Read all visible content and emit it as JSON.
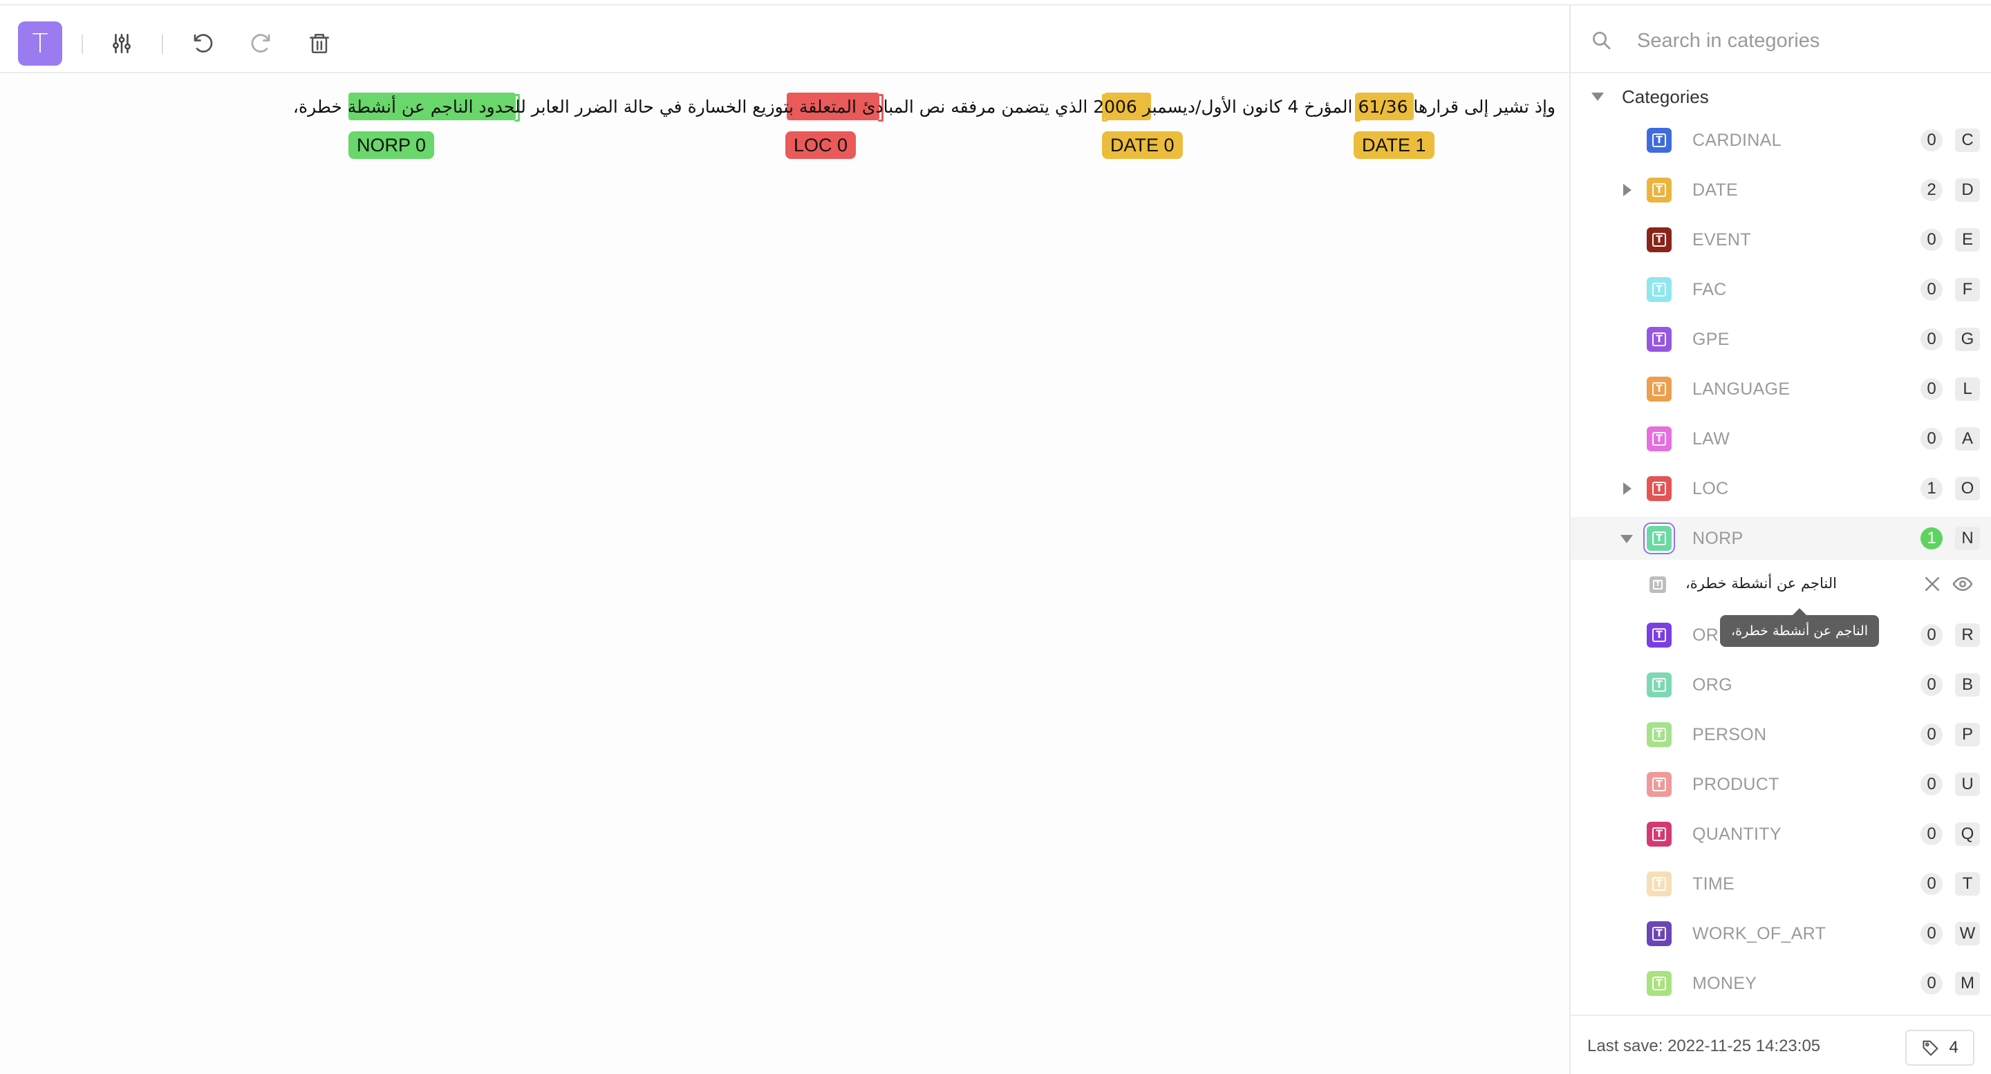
{
  "toolbar": {
    "text_tool_glyph": "T",
    "icons": [
      "text-tool-icon",
      "settings-sliders-icon",
      "undo-icon",
      "redo-icon",
      "trash-icon"
    ]
  },
  "document": {
    "text": "وإذ تشير إلى قرارها 61/36 المؤرخ 4 كانون الأول/ديسمبر 2006 الذي يتضمن مرفقه نص المبادئ المتعلقة بتوزيع الخسارة في حالة الضرر العابر للحدود الناجم عن أنشطة خطرة،",
    "labels": [
      {
        "name": "NORP",
        "index": "0",
        "text": "NORP 0",
        "color": "#69d76c"
      },
      {
        "name": "LOC",
        "index": "0",
        "text": "LOC 0",
        "color": "#ea5a5a"
      },
      {
        "name": "DATE",
        "index": "0",
        "text": "DATE 0",
        "color": "#ecbd3c"
      },
      {
        "name": "DATE",
        "index": "1",
        "text": "DATE 1",
        "color": "#ecbd3c"
      }
    ]
  },
  "sidebar": {
    "search_placeholder": "Search in categories",
    "categories_label": "Categories",
    "categories": [
      {
        "name": "CARDINAL",
        "count": "0",
        "key": "C",
        "color": "#3f6cdd"
      },
      {
        "name": "DATE",
        "count": "2",
        "key": "D",
        "color": "#ecb43c",
        "expandable": true
      },
      {
        "name": "EVENT",
        "count": "0",
        "key": "E",
        "color": "#8a2419"
      },
      {
        "name": "FAC",
        "count": "0",
        "key": "F",
        "color": "#8fe6ee"
      },
      {
        "name": "GPE",
        "count": "0",
        "key": "G",
        "color": "#9656e0"
      },
      {
        "name": "LANGUAGE",
        "count": "0",
        "key": "L",
        "color": "#ee9e4c"
      },
      {
        "name": "LAW",
        "count": "0",
        "key": "A",
        "color": "#e56fe0"
      },
      {
        "name": "LOC",
        "count": "1",
        "key": "O",
        "color": "#e35454",
        "expandable": true
      },
      {
        "name": "NORP",
        "count": "1",
        "key": "N",
        "color": "#6ad9a2",
        "expanded": true,
        "active": true
      },
      {
        "name": "ORDINAL",
        "count": "0",
        "key": "R",
        "color": "#7a3fe0"
      },
      {
        "name": "ORG",
        "count": "0",
        "key": "B",
        "color": "#7fd8b4"
      },
      {
        "name": "PERSON",
        "count": "0",
        "key": "P",
        "color": "#a6e28a"
      },
      {
        "name": "PRODUCT",
        "count": "0",
        "key": "U",
        "color": "#ef9a9a"
      },
      {
        "name": "QUANTITY",
        "count": "0",
        "key": "Q",
        "color": "#d33a72"
      },
      {
        "name": "TIME",
        "count": "0",
        "key": "T",
        "color": "#f6dfb6"
      },
      {
        "name": "WORK_OF_ART",
        "count": "0",
        "key": "W",
        "color": "#6b45b5"
      },
      {
        "name": "MONEY",
        "count": "0",
        "key": "M",
        "color": "#a9e27e"
      }
    ],
    "norp_entity": "الناجم عن أنشطة خطرة،",
    "tooltip": "الناجم عن أنشطة خطرة،",
    "entity_icons": [
      "close-icon",
      "eye-icon"
    ]
  },
  "footer": {
    "last_save": "Last save: 2022-11-25 14:23:05",
    "annotation_count": "4"
  }
}
